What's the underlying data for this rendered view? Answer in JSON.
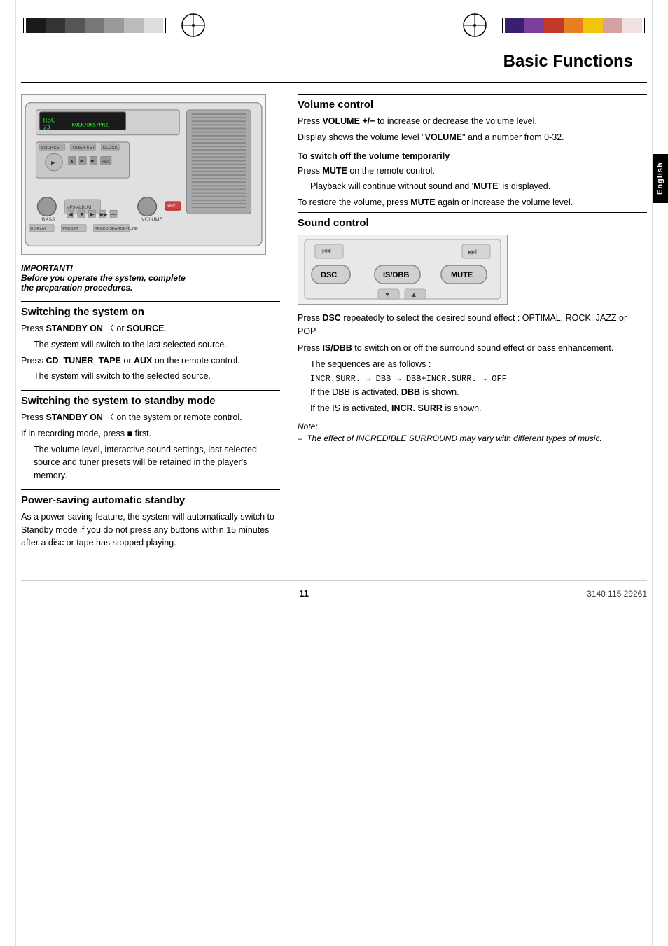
{
  "page": {
    "title": "Basic Functions",
    "page_number": "11",
    "doc_number": "3140 115 29261"
  },
  "header": {
    "left_blocks": [
      {
        "color": "#222222"
      },
      {
        "color": "#444444"
      },
      {
        "color": "#666666"
      },
      {
        "color": "#888888"
      },
      {
        "color": "#aaaaaa"
      },
      {
        "color": "#cccccc"
      },
      {
        "color": "#eeeeee"
      }
    ],
    "right_blocks": [
      {
        "color": "#3b1f6e"
      },
      {
        "color": "#6b2d8b"
      },
      {
        "color": "#c0392b"
      },
      {
        "color": "#e67e22"
      },
      {
        "color": "#f1c40f"
      },
      {
        "color": "#d4a0a0"
      },
      {
        "color": "#e8cccc"
      }
    ]
  },
  "english_tab": {
    "label": "English"
  },
  "important_note": {
    "line1": "IMPORTANT!",
    "line2": "Before you operate the system, complete",
    "line3": "the preparation procedures."
  },
  "left_sections": [
    {
      "id": "switching-on",
      "heading": "Switching the system on",
      "paragraphs": [
        {
          "type": "normal",
          "parts": [
            {
              "text": "Press ",
              "bold": false
            },
            {
              "text": "STANDBY ON ",
              "bold": true
            },
            {
              "text": "〈",
              "bold": false
            },
            {
              "text": " or ",
              "bold": false
            },
            {
              "text": "SOURCE",
              "bold": true
            },
            {
              "text": ".",
              "bold": false
            }
          ]
        },
        {
          "type": "indent",
          "text": "The system will switch to the last selected source."
        },
        {
          "type": "normal",
          "parts": [
            {
              "text": "Press ",
              "bold": false
            },
            {
              "text": "CD",
              "bold": true
            },
            {
              "text": ", ",
              "bold": false
            },
            {
              "text": "TUNER",
              "bold": true
            },
            {
              "text": ", ",
              "bold": false
            },
            {
              "text": "TAPE",
              "bold": true
            },
            {
              "text": " or ",
              "bold": false
            },
            {
              "text": "AUX",
              "bold": true
            },
            {
              "text": " on the remote control.",
              "bold": false
            }
          ]
        },
        {
          "type": "indent",
          "text": "The system will switch to the selected source."
        }
      ]
    },
    {
      "id": "standby-mode",
      "heading": "Switching the system to standby mode",
      "paragraphs": [
        {
          "type": "normal",
          "parts": [
            {
              "text": "Press ",
              "bold": false
            },
            {
              "text": "STANDBY ON ",
              "bold": true
            },
            {
              "text": "〈",
              "bold": false
            },
            {
              "text": " on the system or remote control.",
              "bold": false
            }
          ]
        },
        {
          "type": "normal",
          "parts": [
            {
              "text": "If in recording mode, press ",
              "bold": false
            },
            {
              "text": "■",
              "bold": false
            },
            {
              "text": " first.",
              "bold": false
            }
          ]
        },
        {
          "type": "indent",
          "text": "The volume level, interactive sound settings, last selected source and tuner presets will be retained in the player’s memory."
        }
      ]
    },
    {
      "id": "power-saving",
      "heading": "Power-saving automatic standby",
      "paragraphs": [
        {
          "type": "normal",
          "text": "As a power-saving feature, the system will automatically switch to Standby mode if you do not press any buttons within 15 minutes after a disc or tape has stopped playing."
        }
      ]
    }
  ],
  "right_sections": [
    {
      "id": "volume-control",
      "heading": "Volume control",
      "paragraphs": [
        {
          "type": "normal",
          "parts": [
            {
              "text": "Press ",
              "bold": false
            },
            {
              "text": "VOLUME +/−",
              "bold": true
            },
            {
              "text": " to increase or decrease the volume level.",
              "bold": false
            }
          ]
        },
        {
          "type": "normal",
          "parts": [
            {
              "text": "Display shows the volume level “",
              "bold": false
            },
            {
              "text": "VOLUME",
              "bold": true,
              "underline": true
            },
            {
              "text": "” and a number from 0-32.",
              "bold": false
            }
          ]
        }
      ],
      "subsection": {
        "heading": "To switch off the volume temporarily",
        "paragraphs": [
          {
            "type": "normal",
            "parts": [
              {
                "text": "Press ",
                "bold": false
              },
              {
                "text": "MUTE",
                "bold": true
              },
              {
                "text": " on the remote control.",
                "bold": false
              }
            ]
          },
          {
            "type": "indent",
            "parts": [
              {
                "text": "Playback will continue without sound and ‘",
                "bold": false
              },
              {
                "text": "MUTE",
                "bold": true,
                "underline": true
              },
              {
                "text": "’ is displayed.",
                "bold": false
              }
            ]
          },
          {
            "type": "normal",
            "parts": [
              {
                "text": "To restore the volume, press ",
                "bold": false
              },
              {
                "text": "MUTE",
                "bold": true
              },
              {
                "text": " again or increase the volume level.",
                "bold": false
              }
            ]
          }
        ]
      }
    },
    {
      "id": "sound-control",
      "heading": "Sound control",
      "paragraphs": [
        {
          "type": "normal",
          "parts": [
            {
              "text": "Press ",
              "bold": false
            },
            {
              "text": "DSC",
              "bold": true
            },
            {
              "text": " repeatedly to select the desired sound effect : ",
              "bold": false
            },
            {
              "text": "OPTIMAL, ROCK, JAZZ",
              "bold": false,
              "smallcaps": true
            },
            {
              "text": " or ",
              "bold": false
            },
            {
              "text": "POP",
              "bold": false,
              "smallcaps": true
            },
            {
              "text": ".",
              "bold": false
            }
          ]
        },
        {
          "type": "normal",
          "parts": [
            {
              "text": "Press ",
              "bold": false
            },
            {
              "text": "IS/DBB",
              "bold": true
            },
            {
              "text": " to switch on or off the surround sound effect or bass enhancement.",
              "bold": false
            }
          ]
        },
        {
          "type": "indent",
          "text": "The sequences are as follows :"
        },
        {
          "type": "sequence",
          "text": "INCR.SURR. → DBB → DBB+INCR.SURR. → OFF"
        },
        {
          "type": "indent",
          "parts": [
            {
              "text": "If the DBB is activated, ",
              "bold": false
            },
            {
              "text": "DBB",
              "bold": true
            },
            {
              "text": " is shown.",
              "bold": false
            }
          ]
        },
        {
          "type": "indent",
          "parts": [
            {
              "text": "If the IS is activated, ",
              "bold": false
            },
            {
              "text": "INCR. SURR",
              "bold": true
            },
            {
              "text": " is shown.",
              "bold": false
            }
          ]
        }
      ],
      "note": {
        "label": "Note:",
        "lines": [
          "–  The effect of INCREDIBLE SURROUND may vary with different types of music."
        ]
      }
    }
  ]
}
